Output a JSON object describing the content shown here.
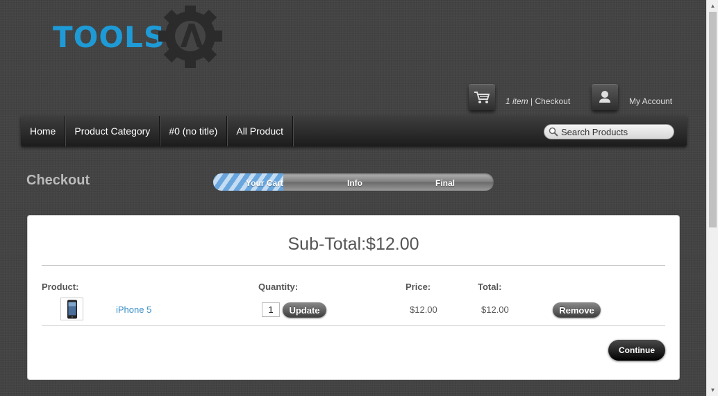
{
  "logo": {
    "text": "TOOLS",
    "badge_letter": "A",
    "colors": {
      "text": "#1e9ad6",
      "gear": "#2b2b2b"
    }
  },
  "header": {
    "cart": {
      "items_label": "1 item",
      "separator": " | ",
      "checkout_label": "Checkout",
      "icon": "cart-icon"
    },
    "account": {
      "label": "My Account",
      "icon": "user-icon"
    }
  },
  "nav": {
    "items": [
      {
        "label": "Home"
      },
      {
        "label": "Product Category"
      },
      {
        "label": "#0 (no title)"
      },
      {
        "label": "All Product"
      }
    ],
    "search_placeholder": "Search Products"
  },
  "page": {
    "title": "Checkout"
  },
  "progress": {
    "steps": [
      "Your Cart",
      "Info",
      "Final"
    ],
    "current_step": 1,
    "fill_fraction": 0.25
  },
  "cart": {
    "subtotal_label": "Sub-Total:",
    "subtotal_value": "$12.00",
    "headers": {
      "product": "Product:",
      "quantity": "Quantity:",
      "price": "Price:",
      "total": "Total:"
    },
    "rows": [
      {
        "name": "iPhone 5",
        "quantity": "1",
        "price": "$12.00",
        "total": "$12.00"
      }
    ],
    "update_label": "Update",
    "remove_label": "Remove",
    "continue_label": "Continue"
  }
}
